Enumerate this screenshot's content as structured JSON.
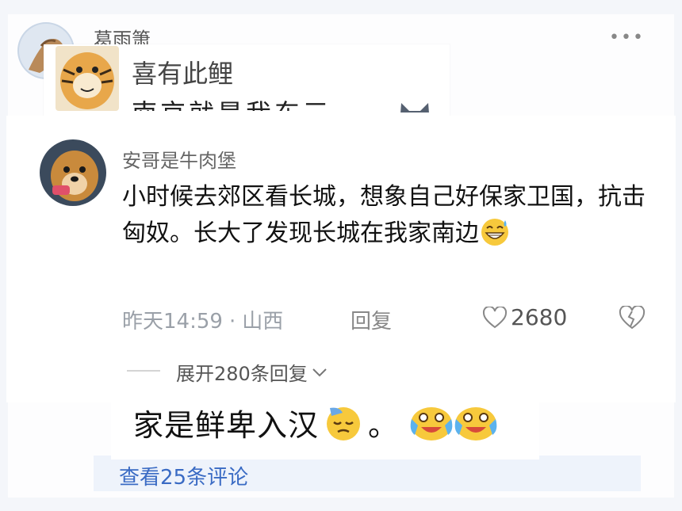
{
  "background_post": {
    "username": "葛雨箫",
    "more_label": "•••",
    "view_comments_link": "查看25条评论"
  },
  "overlay_comment": {
    "username": "喜有此鲤",
    "truncated_text": "南京就是我东三"
  },
  "main_comment": {
    "username": "安哥是牛肉堡",
    "body": "小时候去郊区看长城，想象自己好保家卫国，抗击匈奴。长大了发现长城在我家南边",
    "time": "昨天14:59",
    "separator": "·",
    "location": "山西",
    "reply_label": "回复",
    "like_count": "2680",
    "expand_replies": "展开280条回复"
  },
  "caption": {
    "text": "家是鲜卑入汉",
    "period": "。"
  },
  "colors": {
    "link": "#3a6bc4",
    "meta": "#9aa0a8",
    "text": "#111111"
  }
}
